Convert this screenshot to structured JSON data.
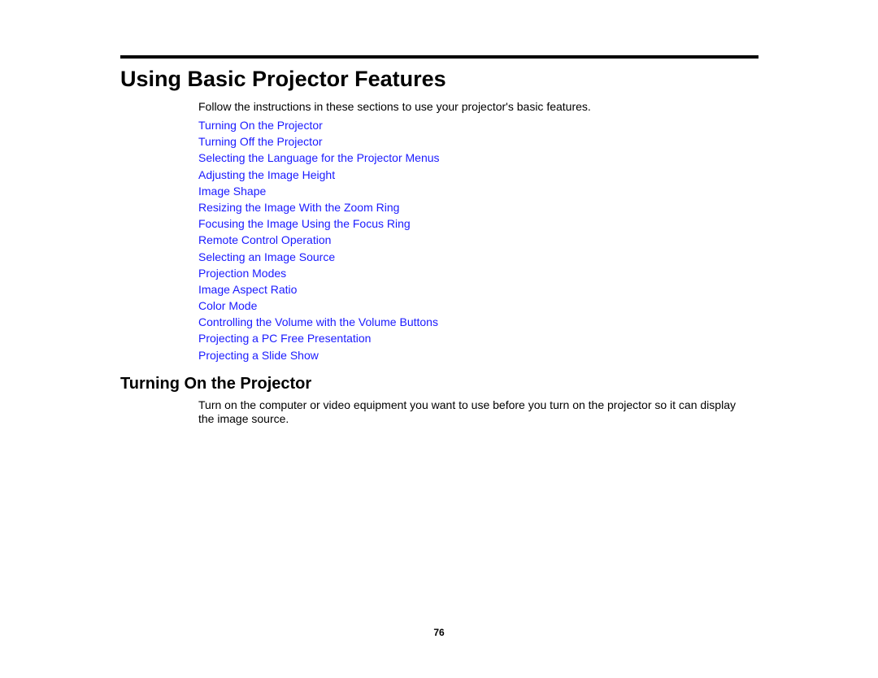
{
  "page": {
    "title": "Using Basic Projector Features",
    "intro": "Follow the instructions in these sections to use your projector's basic features.",
    "links": [
      "Turning On the Projector",
      "Turning Off the Projector",
      "Selecting the Language for the Projector Menus",
      "Adjusting the Image Height",
      "Image Shape",
      "Resizing the Image With the Zoom Ring",
      "Focusing the Image Using the Focus Ring",
      "Remote Control Operation",
      "Selecting an Image Source",
      "Projection Modes",
      "Image Aspect Ratio",
      "Color Mode",
      "Controlling the Volume with the Volume Buttons",
      "Projecting a PC Free Presentation",
      "Projecting a Slide Show"
    ],
    "section": {
      "heading": "Turning On the Projector",
      "body": "Turn on the computer or video equipment you want to use before you turn on the projector so it can display the image source."
    },
    "page_number": "76",
    "link_color": "#1a1aff"
  }
}
